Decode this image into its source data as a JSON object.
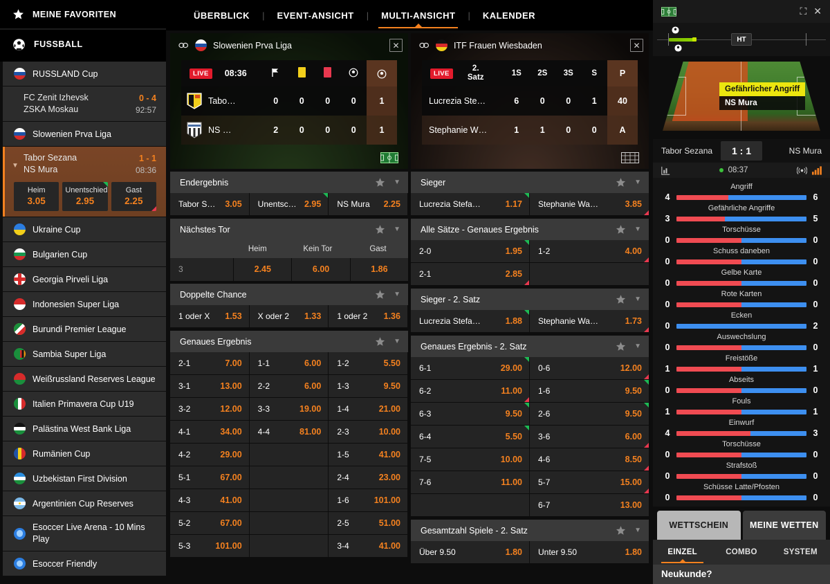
{
  "sidebar": {
    "favorites_label": "MEINE FAVORITEN",
    "sport_label": "FUSSBALL",
    "groups": [
      {
        "league": "RUSSLAND Cup",
        "flag": "ru",
        "matches": [
          {
            "home": "FC Zenit Izhevsk",
            "away": "ZSKA Moskau",
            "score": "0 - 4",
            "time": "92:57",
            "active": false
          }
        ]
      },
      {
        "league": "Slowenien Prva Liga",
        "flag": "si",
        "matches": [
          {
            "home": "Tabor Sezana",
            "away": "NS Mura",
            "score": "1 - 1",
            "time": "08:36",
            "active": true,
            "odds": [
              {
                "label": "Heim",
                "value": "3.05",
                "trend": "none"
              },
              {
                "label": "Unentschieden",
                "value": "2.95",
                "trend": "up"
              },
              {
                "label": "Gast",
                "value": "2.25",
                "trend": "down"
              }
            ]
          }
        ]
      }
    ],
    "leagues": [
      {
        "name": "Ukraine Cup",
        "flag": "ua"
      },
      {
        "name": "Bulgarien Cup",
        "flag": "bg"
      },
      {
        "name": "Georgia Pirveli Liga",
        "flag": "ge"
      },
      {
        "name": "Indonesien Super Liga",
        "flag": "id"
      },
      {
        "name": "Burundi Premier League",
        "flag": "bi"
      },
      {
        "name": "Sambia Super Liga",
        "flag": "zm"
      },
      {
        "name": "Weißrussland Reserves League",
        "flag": "by"
      },
      {
        "name": "Italien Primavera Cup U19",
        "flag": "it"
      },
      {
        "name": "Palästina West Bank Liga",
        "flag": "ps"
      },
      {
        "name": "Rumänien Cup",
        "flag": "ro"
      },
      {
        "name": "Uzbekistan First Division",
        "flag": "uz"
      },
      {
        "name": "Argentinien Cup Reserves",
        "flag": "ar"
      },
      {
        "name": "Esoccer Live Arena - 10 Mins Play",
        "flag": "es1"
      },
      {
        "name": "Esoccer Friendly",
        "flag": "es1"
      }
    ]
  },
  "topnav": {
    "tabs": [
      {
        "label": "ÜBERBLICK",
        "active": false
      },
      {
        "label": "EVENT-ANSICHT",
        "active": false
      },
      {
        "label": "MULTI-ANSICHT",
        "active": true
      },
      {
        "label": "KALENDER",
        "active": false
      }
    ],
    "divider": "|"
  },
  "left_card": {
    "title": "Slowenien Prva Liga",
    "flag": "si",
    "close": "✕",
    "live": "LIVE",
    "clock": "08:36",
    "columns": [
      "corner",
      "yellow",
      "red",
      "ball"
    ],
    "rows": [
      {
        "team": "Tabo…",
        "cells": [
          "0",
          "0",
          "0",
          "0"
        ],
        "points": "1"
      },
      {
        "team": "NS …",
        "cells": [
          "2",
          "0",
          "0",
          "0"
        ],
        "points": "1"
      }
    ]
  },
  "right_card": {
    "title": "ITF Frauen Wiesbaden",
    "flag": "de",
    "close": "✕",
    "live": "LIVE",
    "set_label": "2. Satz",
    "columns": [
      "1S",
      "2S",
      "3S",
      "S"
    ],
    "points_header": "P",
    "rows": [
      {
        "team": "Lucrezia Ste…",
        "cells": [
          "6",
          "0",
          "0",
          "1"
        ],
        "points": "40"
      },
      {
        "team": "Stephanie W…",
        "cells": [
          "1",
          "1",
          "0",
          "0"
        ],
        "points": "A"
      }
    ]
  },
  "left_markets": [
    {
      "title": "Endergebnis",
      "layout": "three",
      "selections": [
        {
          "name": "Tabor Se…",
          "odds": "3.05",
          "trend": "none"
        },
        {
          "name": "Unentsc…",
          "odds": "2.95",
          "trend": "up"
        },
        {
          "name": "NS Mura",
          "odds": "2.25",
          "trend": "none"
        }
      ]
    },
    {
      "title": "Nächstes Tor",
      "layout": "nexttor",
      "headers": [
        "",
        "Heim",
        "Kein Tor",
        "Gast"
      ],
      "row": {
        "label": "3",
        "values": [
          "2.45",
          "6.00",
          "1.86"
        ]
      }
    },
    {
      "title": "Doppelte Chance",
      "layout": "three",
      "selections": [
        {
          "name": "1 oder X",
          "odds": "1.53",
          "trend": "none"
        },
        {
          "name": "X oder 2",
          "odds": "1.33",
          "trend": "none"
        },
        {
          "name": "1 oder 2",
          "odds": "1.36",
          "trend": "none"
        }
      ]
    },
    {
      "title": "Genaues Ergebnis",
      "layout": "three",
      "selections": [
        {
          "name": "2-1",
          "odds": "7.00",
          "trend": "none"
        },
        {
          "name": "1-1",
          "odds": "6.00",
          "trend": "none"
        },
        {
          "name": "1-2",
          "odds": "5.50",
          "trend": "none"
        },
        {
          "name": "3-1",
          "odds": "13.00",
          "trend": "none"
        },
        {
          "name": "2-2",
          "odds": "6.00",
          "trend": "none"
        },
        {
          "name": "1-3",
          "odds": "9.50",
          "trend": "none"
        },
        {
          "name": "3-2",
          "odds": "12.00",
          "trend": "none"
        },
        {
          "name": "3-3",
          "odds": "19.00",
          "trend": "none"
        },
        {
          "name": "1-4",
          "odds": "21.00",
          "trend": "none"
        },
        {
          "name": "4-1",
          "odds": "34.00",
          "trend": "none"
        },
        {
          "name": "4-4",
          "odds": "81.00",
          "trend": "none"
        },
        {
          "name": "2-3",
          "odds": "10.00",
          "trend": "none"
        },
        {
          "name": "4-2",
          "odds": "29.00",
          "trend": "none"
        },
        {
          "name": "",
          "odds": "",
          "trend": "none"
        },
        {
          "name": "1-5",
          "odds": "41.00",
          "trend": "none"
        },
        {
          "name": "5-1",
          "odds": "67.00",
          "trend": "none"
        },
        {
          "name": "",
          "odds": "",
          "trend": "none"
        },
        {
          "name": "2-4",
          "odds": "23.00",
          "trend": "none"
        },
        {
          "name": "4-3",
          "odds": "41.00",
          "trend": "none"
        },
        {
          "name": "",
          "odds": "",
          "trend": "none"
        },
        {
          "name": "1-6",
          "odds": "101.00",
          "trend": "none"
        },
        {
          "name": "5-2",
          "odds": "67.00",
          "trend": "none"
        },
        {
          "name": "",
          "odds": "",
          "trend": "none"
        },
        {
          "name": "2-5",
          "odds": "51.00",
          "trend": "none"
        },
        {
          "name": "5-3",
          "odds": "101.00",
          "trend": "none"
        },
        {
          "name": "",
          "odds": "",
          "trend": "none"
        },
        {
          "name": "3-4",
          "odds": "41.00",
          "trend": "none"
        }
      ]
    }
  ],
  "right_markets": [
    {
      "title": "Sieger",
      "layout": "two",
      "selections": [
        {
          "name": "Lucrezia Stefanini",
          "odds": "1.17",
          "trend": "up"
        },
        {
          "name": "Stephanie Wagner",
          "odds": "3.85",
          "trend": "down"
        }
      ]
    },
    {
      "title": "Alle Sätze - Genaues Ergebnis",
      "layout": "two",
      "selections": [
        {
          "name": "2-0",
          "odds": "1.95",
          "trend": "up"
        },
        {
          "name": "1-2",
          "odds": "4.00",
          "trend": "down"
        },
        {
          "name": "2-1",
          "odds": "2.85",
          "trend": "down"
        },
        {
          "name": "",
          "odds": "",
          "trend": "none"
        }
      ]
    },
    {
      "title": "Sieger - 2. Satz",
      "layout": "two",
      "selections": [
        {
          "name": "Lucrezia Stefanini",
          "odds": "1.88",
          "trend": "up"
        },
        {
          "name": "Stephanie Wagner",
          "odds": "1.73",
          "trend": "down"
        }
      ]
    },
    {
      "title": "Genaues Ergebnis - 2. Satz",
      "layout": "two",
      "selections": [
        {
          "name": "6-1",
          "odds": "29.00",
          "trend": "up"
        },
        {
          "name": "0-6",
          "odds": "12.00",
          "trend": "down"
        },
        {
          "name": "6-2",
          "odds": "11.00",
          "trend": "down"
        },
        {
          "name": "1-6",
          "odds": "9.50",
          "trend": "up"
        },
        {
          "name": "6-3",
          "odds": "9.50",
          "trend": "up"
        },
        {
          "name": "2-6",
          "odds": "9.50",
          "trend": "up"
        },
        {
          "name": "6-4",
          "odds": "5.50",
          "trend": "up"
        },
        {
          "name": "3-6",
          "odds": "6.00",
          "trend": "down"
        },
        {
          "name": "7-5",
          "odds": "10.00",
          "trend": "none"
        },
        {
          "name": "4-6",
          "odds": "8.50",
          "trend": "down"
        },
        {
          "name": "7-6",
          "odds": "11.00",
          "trend": "none"
        },
        {
          "name": "5-7",
          "odds": "15.00",
          "trend": "down"
        },
        {
          "name": "",
          "odds": "",
          "trend": "none"
        },
        {
          "name": "6-7",
          "odds": "13.00",
          "trend": "none"
        }
      ]
    },
    {
      "title": "Gesamtzahl Spiele - 2. Satz",
      "layout": "two",
      "selections": [
        {
          "name": "Über  9.50",
          "odds": "1.80",
          "trend": "none"
        },
        {
          "name": "Unter  9.50",
          "odds": "1.80",
          "trend": "none"
        }
      ]
    }
  ],
  "live_panel": {
    "pitch_icon": "pitch-icon",
    "fullscreen": "⛶",
    "close": "✕",
    "halftime_label": "HT",
    "tooltip_event": "Gefährlicher Angriff",
    "tooltip_team": "NS Mura",
    "home_team": "Tabor Sezana",
    "away_team": "NS Mura",
    "score": "1 : 1",
    "clock": "08:37",
    "stats": [
      {
        "label": "Angriff",
        "home": "4",
        "away": "6",
        "home_pct": 40
      },
      {
        "label": "Gefährliche Angriffe",
        "home": "3",
        "away": "5",
        "home_pct": 37
      },
      {
        "label": "Torschüsse",
        "home": "0",
        "away": "0",
        "home_pct": 50
      },
      {
        "label": "Schuss daneben",
        "home": "0",
        "away": "0",
        "home_pct": 50
      },
      {
        "label": "Gelbe Karte",
        "home": "0",
        "away": "0",
        "home_pct": 50
      },
      {
        "label": "Rote Karten",
        "home": "0",
        "away": "0",
        "home_pct": 50
      },
      {
        "label": "Ecken",
        "home": "0",
        "away": "2",
        "home_pct": 0
      },
      {
        "label": "Auswechslung",
        "home": "0",
        "away": "0",
        "home_pct": 50
      },
      {
        "label": "Freistöße",
        "home": "1",
        "away": "1",
        "home_pct": 50
      },
      {
        "label": "Abseits",
        "home": "0",
        "away": "0",
        "home_pct": 50
      },
      {
        "label": "Fouls",
        "home": "1",
        "away": "1",
        "home_pct": 50
      },
      {
        "label": "Einwurf",
        "home": "4",
        "away": "3",
        "home_pct": 57
      },
      {
        "label": "Torschüsse",
        "home": "0",
        "away": "0",
        "home_pct": 50
      },
      {
        "label": "Strafstoß",
        "home": "0",
        "away": "0",
        "home_pct": 50
      },
      {
        "label": "Schüsse Latte/Pfosten",
        "home": "0",
        "away": "0",
        "home_pct": 50
      }
    ]
  },
  "betslip": {
    "tabs": [
      {
        "label": "WETTSCHEIN",
        "active": true
      },
      {
        "label": "MEINE WETTEN",
        "active": false
      }
    ],
    "subtabs": [
      {
        "label": "EINZEL",
        "active": true
      },
      {
        "label": "COMBO",
        "active": false
      },
      {
        "label": "SYSTEM",
        "active": false
      }
    ],
    "new_customer": "Neukunde?"
  },
  "colors": {
    "accent": "#f4811f",
    "up": "#1db954",
    "down": "#e8384f",
    "live": "#e21b2c",
    "home_bar": "#f04b52",
    "away_bar": "#3d8ff0"
  }
}
